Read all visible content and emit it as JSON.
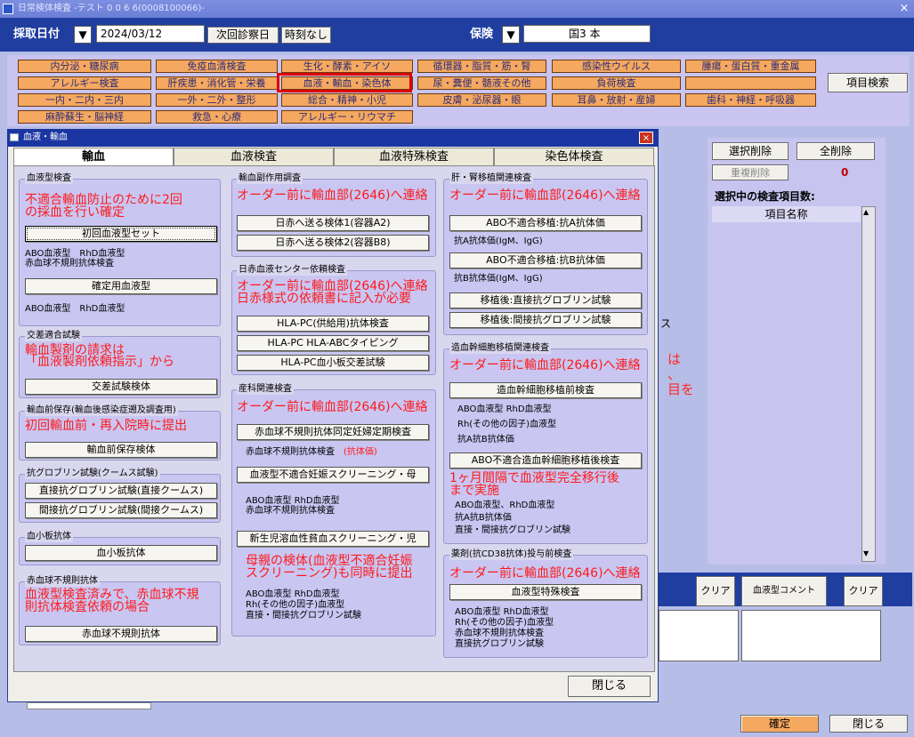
{
  "window": {
    "title": "日常検体検査 -テスト  0 0 6 6(0008100066)-",
    "close": "×"
  },
  "header": {
    "date_label": "採取日付",
    "date_value": "2024/03/12",
    "next_visit": "次回診察日",
    "no_time": "時刻なし",
    "insurance_label": "保険",
    "insurance_value": "国3  本",
    "dropdown": "▼"
  },
  "categories": {
    "row1": [
      "内分泌・糖尿病",
      "免疫血清検査",
      "生化・酵素・アイソ",
      "循環器・脂質・筋・腎",
      "感染性ウイルス",
      "腫瘍・蛋白質・重金属"
    ],
    "row2": [
      "アレルギー検査",
      "肝疾患・消化管・栄養",
      "血液・輸血・染色体",
      "尿・糞便・髄液その他",
      "負荷検査"
    ],
    "row3": [
      "一内・二内・三内",
      "一外・二外・整形",
      "総合・精神・小児",
      "皮膚・泌尿器・眼",
      "耳鼻・放射・産婦",
      "歯科・神経・呼吸器"
    ],
    "row4": [
      "麻酔蘇生・脳神経",
      "救急・心療",
      "アレルギー・リウマチ"
    ],
    "search": "項目検索"
  },
  "right": {
    "select_delete": "選択削除",
    "all_delete": "全削除",
    "dup_delete": "重複削除",
    "count": "0",
    "selected_label": "選択中の検査項目数:",
    "col_header": "項目名称",
    "clear1": "クリア",
    "blood_comment": "血液型コメント",
    "clear2": "クリア",
    "confirm": "確定",
    "close": "閉じる",
    "side_text": [
      "は",
      "、",
      "目を"
    ],
    "frag_x": "ス"
  },
  "dialog": {
    "title": "血液・輸血",
    "close": "×",
    "tabs": [
      "輸血",
      "血液検査",
      "血液特殊検査",
      "染色体検査"
    ],
    "close_button": "閉じる",
    "col1": {
      "bt": {
        "title": "血液型検査",
        "red": [
          "不適合輸血防止のために2回",
          "の採血を行い確定"
        ],
        "btn1": "初回血液型セット",
        "t1": [
          "ABO血液型　RhD血液型",
          "赤血球不規則抗体検査"
        ],
        "btn2": "確定用血液型",
        "t2": "ABO血液型　RhD血液型"
      },
      "cm": {
        "title": "交差適合試験",
        "red": [
          "輸血製剤の請求は",
          "「血液製剤依頼指示」から"
        ],
        "btn": "交差試験検体"
      },
      "pre": {
        "title": "輸血前保存(輸血後感染症遡及調査用)",
        "red": "初回輸血前・再入院時に提出",
        "btn": "輸血前保存検体"
      },
      "ag": {
        "title": "抗グロブリン試験(クームス試験)",
        "btn1": "直接抗グロブリン試験(直接クームス)",
        "btn2": "間接抗グロブリン試験(間接クームス)"
      },
      "plt": {
        "title": "血小板抗体",
        "btn": "血小板抗体"
      },
      "irr": {
        "title": "赤血球不規則抗体",
        "red": [
          "血液型検査済みで、赤血球不規",
          "則抗体検査依頼の場合"
        ],
        "btn": "赤血球不規則抗体"
      }
    },
    "col2": {
      "side": {
        "title": "輸血副作用調査",
        "red": "オーダー前に輸血部(2646)へ連絡",
        "btn1": "日赤へ送る検体1(容器A2)",
        "btn2": "日赤へ送る検体2(容器B8)"
      },
      "jrc": {
        "title": "日赤血液センター依頼検査",
        "red": [
          "オーダー前に輸血部(2646)へ連絡",
          "日赤様式の依頼書に記入が必要"
        ],
        "btn1": "HLA-PC(供給用)抗体検査",
        "btn2": "HLA-PC HLA-ABCタイピング",
        "btn3": "HLA-PC血小板交差試験"
      },
      "obs": {
        "title": "産科関連検査",
        "red": "オーダー前に輸血部(2646)へ連絡",
        "btn1": "赤血球不規則抗体同定妊婦定期検査",
        "t1a": "赤血球不規則抗体検査",
        "t1b": "(抗体価)",
        "btn2": "血液型不適合妊娠スクリーニング・母",
        "t2": [
          "ABO血液型  RhD血液型",
          "赤血球不規則抗体検査"
        ],
        "btn3": "新生児溶血性貧血スクリーニング・児",
        "red2": [
          "母親の検体(血液型不適合妊娠",
          "スクリーニング)も同時に提出"
        ],
        "t3": [
          "ABO血液型  RhD血液型",
          "Rh(その他の因子)血液型",
          "直接・間接抗グロブリン試験"
        ]
      }
    },
    "col3": {
      "lk": {
        "title": "肝・腎移植関連検査",
        "red": "オーダー前に輸血部(2646)へ連絡",
        "btn1": "ABO不適合移植:抗A抗体価",
        "t1": "抗A抗体価(IgM、IgG)",
        "btn2": "ABO不適合移植:抗B抗体価",
        "t2": "抗B抗体価(IgM、IgG)",
        "btn3": "移植後:直接抗グロブリン試験",
        "btn4": "移植後:間接抗グロブリン試験"
      },
      "hsc": {
        "title": "造血幹細胞移植関連検査",
        "red": "オーダー前に輸血部(2646)へ連絡",
        "btn1": "造血幹細胞移植前検査",
        "t1": [
          "ABO血液型  RhD血液型",
          "Rh(その他の因子)血液型",
          "抗A抗B抗体価"
        ],
        "btn2": "ABO不適合造血幹細胞移植後検査",
        "red2": [
          "1ヶ月間隔で血液型完全移行後",
          "まで実施"
        ],
        "t2": [
          "ABO血液型、RhD血液型",
          "抗A抗B抗体価",
          "直接・間接抗グロブリン試験"
        ]
      },
      "dara": {
        "title": "薬剤(抗CD38抗体)投与前検査",
        "red": "オーダー前に輸血部(2646)へ連絡",
        "btn": "血液型特殊検査",
        "t": [
          "ABO血液型  RhD血液型",
          "Rh(その他の因子)血液型",
          "赤血球不規則抗体検査",
          "直接抗グロブリン試験"
        ]
      }
    }
  }
}
